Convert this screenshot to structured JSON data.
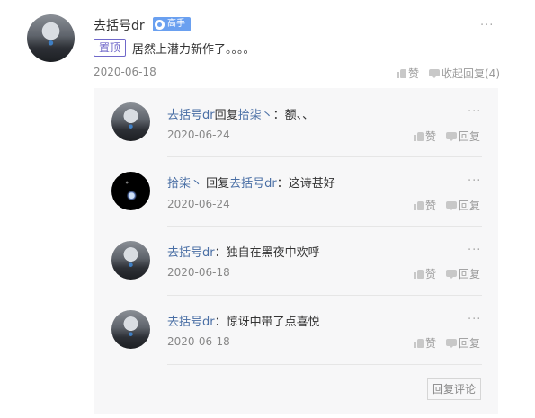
{
  "post": {
    "author": "去括号dr",
    "badge": "高手",
    "pin_tag": "置顶",
    "content": "居然上潜力新作了。。。。",
    "date": "2020-06-18",
    "like_label": "赞",
    "collapse_label": "收起回复(4)"
  },
  "replies": [
    {
      "author": "去括号dr",
      "reply_word": "回复",
      "target": "拾柒丶",
      "text": "：额、、",
      "date": "2020-06-24",
      "like_label": "赞",
      "reply_label": "回复"
    },
    {
      "author": "拾柒丶",
      "reply_word": " 回复",
      "target": "去括号dr",
      "text": "：这诗甚好",
      "date": "2020-06-24",
      "like_label": "赞",
      "reply_label": "回复"
    },
    {
      "author": "去括号dr",
      "text": "：独自在黑夜中欢呼",
      "date": "2020-06-18",
      "like_label": "赞",
      "reply_label": "回复"
    },
    {
      "author": "去括号dr",
      "text": "：惊讶中带了点喜悦",
      "date": "2020-06-18",
      "like_label": "赞",
      "reply_label": "回复"
    }
  ],
  "reply_comment_label": "回复评论",
  "more_symbol": "···"
}
